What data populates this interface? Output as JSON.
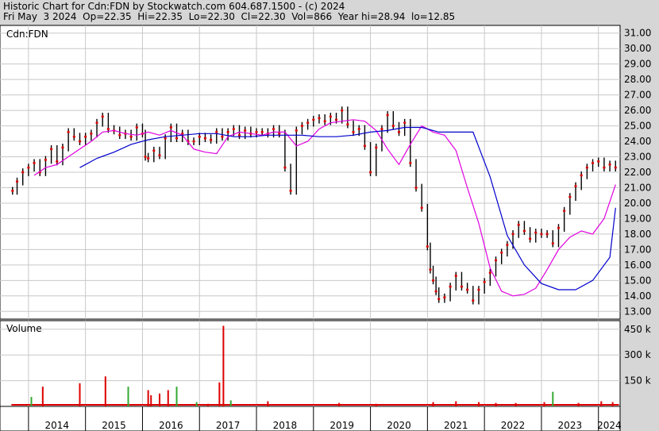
{
  "header": {
    "title": "Historic Chart for Cdn:FDN by Stockwatch.com 604.687.1500 - (c) 2024",
    "quote": "Fri May  3 2024  Op=22.35  Hi=22.35  Lo=22.30  Cl=22.30  Vol=866  Year hi=28.94  lo=12.85"
  },
  "colors": {
    "background": "#d6d6d6",
    "plot_bg": "#ffffff",
    "grid": "#c8c8c8",
    "price_bar": "#000000",
    "price_dot": "#d40000",
    "ma_short": "#e000e0",
    "ma_long": "#0000cc",
    "vol_up": "#33aa33",
    "vol_down": "#dd0000"
  },
  "chart_data": [
    {
      "type": "line",
      "symbol": "Cdn:FDN",
      "ylim": [
        12.5,
        31.5
      ],
      "yticks": [
        13,
        14,
        15,
        16,
        17,
        18,
        19,
        20,
        21,
        22,
        23,
        24,
        25,
        26,
        27,
        28,
        29,
        30,
        31
      ],
      "ytick_labels": [
        "13.00",
        "14.00",
        "15.00",
        "16.00",
        "17.00",
        "18.00",
        "19.00",
        "20.00",
        "21.00",
        "22.00",
        "23.00",
        "24.00",
        "25.00",
        "26.00",
        "27.00",
        "28.00",
        "29.00",
        "30.00",
        "31.00"
      ],
      "x_labels": [
        "2014",
        "2015",
        "2016",
        "2017",
        "2018",
        "2019",
        "2020",
        "2021",
        "2022",
        "2023",
        "2024"
      ],
      "x_label_pos": [
        2014.0,
        2015.0,
        2016.0,
        2017.0,
        2018.0,
        2019.0,
        2020.0,
        2021.0,
        2022.0,
        2023.0,
        2024.0
      ],
      "x_range": [
        2013.5,
        2024.38
      ],
      "series": [
        {
          "name": "",
          "role": "price",
          "x": [
            2013.72,
            2013.8,
            2013.9,
            2014.0,
            2014.1,
            2014.2,
            2014.3,
            2014.4,
            2014.5,
            2014.6,
            2014.7,
            2014.8,
            2014.9,
            2015.0,
            2015.1,
            2015.2,
            2015.3,
            2015.4,
            2015.5,
            2015.6,
            2015.7,
            2015.8,
            2015.9,
            2016.0,
            2016.05,
            2016.1,
            2016.2,
            2016.3,
            2016.4,
            2016.5,
            2016.6,
            2016.7,
            2016.8,
            2016.9,
            2017.0,
            2017.1,
            2017.2,
            2017.3,
            2017.4,
            2017.5,
            2017.6,
            2017.7,
            2017.8,
            2017.9,
            2018.0,
            2018.1,
            2018.2,
            2018.3,
            2018.4,
            2018.5,
            2018.6,
            2018.7,
            2018.8,
            2018.9,
            2019.0,
            2019.1,
            2019.2,
            2019.3,
            2019.4,
            2019.5,
            2019.6,
            2019.7,
            2019.8,
            2019.9,
            2020.0,
            2020.1,
            2020.2,
            2020.3,
            2020.4,
            2020.5,
            2020.6,
            2020.7,
            2020.8,
            2020.9,
            2021.0,
            2021.05,
            2021.1,
            2021.15,
            2021.2,
            2021.3,
            2021.4,
            2021.5,
            2021.6,
            2021.7,
            2021.8,
            2021.9,
            2022.0,
            2022.1,
            2022.2,
            2022.3,
            2022.4,
            2022.5,
            2022.6,
            2022.7,
            2022.8,
            2022.9,
            2023.0,
            2023.1,
            2023.2,
            2023.3,
            2023.4,
            2023.5,
            2023.6,
            2023.7,
            2023.8,
            2023.9,
            2024.0,
            2024.1,
            2024.2,
            2024.3
          ],
          "y": [
            20.8,
            21.4,
            22.0,
            22.3,
            22.6,
            22.0,
            22.8,
            23.5,
            22.7,
            23.6,
            24.6,
            24.3,
            24.0,
            24.3,
            24.5,
            25.2,
            25.6,
            24.8,
            24.7,
            24.4,
            24.5,
            24.3,
            24.9,
            24.5,
            23.0,
            22.9,
            23.4,
            23.1,
            24.2,
            24.9,
            24.2,
            24.5,
            24.0,
            24.0,
            24.3,
            24.2,
            24.1,
            24.6,
            24.3,
            24.6,
            24.8,
            24.4,
            24.7,
            24.5,
            24.6,
            24.6,
            24.5,
            24.8,
            24.5,
            22.3,
            20.8,
            24.7,
            25.0,
            25.2,
            25.4,
            25.5,
            25.3,
            25.6,
            25.4,
            26.0,
            25.1,
            24.6,
            24.8,
            23.7,
            22.0,
            23.6,
            24.8,
            25.7,
            25.0,
            24.6,
            25.2,
            22.6,
            21.0,
            19.7,
            17.2,
            15.7,
            15.0,
            14.3,
            13.8,
            13.9,
            14.6,
            15.3,
            14.6,
            14.4,
            13.7,
            14.4,
            14.9,
            15.5,
            16.3,
            16.8,
            17.3,
            18.0,
            18.6,
            18.2,
            17.7,
            18.1,
            18.0,
            18.0,
            17.4,
            18.4,
            19.5,
            20.4,
            21.1,
            21.8,
            22.3,
            22.6,
            22.7,
            22.3,
            22.5,
            22.3
          ]
        },
        {
          "name": "",
          "role": "moving_average_short",
          "x": [
            2014.1,
            2014.3,
            2014.5,
            2014.7,
            2014.9,
            2015.1,
            2015.3,
            2015.5,
            2015.7,
            2015.9,
            2016.1,
            2016.3,
            2016.5,
            2016.7,
            2016.9,
            2017.1,
            2017.3,
            2017.5,
            2017.7,
            2017.9,
            2018.1,
            2018.3,
            2018.5,
            2018.7,
            2018.9,
            2019.1,
            2019.3,
            2019.5,
            2019.7,
            2019.9,
            2020.1,
            2020.3,
            2020.5,
            2020.7,
            2020.9,
            2021.1,
            2021.3,
            2021.5,
            2021.7,
            2021.9,
            2022.1,
            2022.3,
            2022.5,
            2022.7,
            2022.9,
            2023.1,
            2023.3,
            2023.5,
            2023.7,
            2023.9,
            2024.1,
            2024.3
          ],
          "y": [
            21.8,
            22.3,
            22.5,
            23.0,
            23.5,
            24.0,
            24.6,
            24.7,
            24.5,
            24.4,
            24.6,
            24.4,
            24.7,
            24.4,
            23.5,
            23.3,
            23.2,
            24.3,
            24.6,
            24.5,
            24.4,
            24.6,
            24.6,
            23.7,
            24.0,
            24.8,
            25.2,
            25.3,
            25.4,
            25.3,
            24.7,
            23.5,
            22.5,
            23.8,
            25.0,
            24.6,
            24.4,
            23.4,
            21.0,
            18.7,
            15.8,
            14.3,
            14.0,
            14.1,
            14.5,
            15.7,
            17.0,
            17.8,
            18.2,
            18.0,
            19.0,
            21.2
          ]
        },
        {
          "name": "",
          "role": "moving_average_long",
          "x": [
            2014.9,
            2015.2,
            2015.5,
            2015.8,
            2016.1,
            2016.4,
            2016.7,
            2017.0,
            2017.3,
            2017.6,
            2017.9,
            2018.2,
            2018.5,
            2018.8,
            2019.1,
            2019.4,
            2019.7,
            2020.0,
            2020.3,
            2020.6,
            2020.9,
            2021.2,
            2021.5,
            2021.8,
            2022.1,
            2022.4,
            2022.7,
            2023.0,
            2023.3,
            2023.6,
            2023.9,
            2024.2,
            2024.3
          ],
          "y": [
            22.3,
            22.9,
            23.3,
            23.8,
            24.1,
            24.3,
            24.4,
            24.5,
            24.5,
            24.3,
            24.3,
            24.4,
            24.4,
            24.4,
            24.3,
            24.3,
            24.4,
            24.6,
            24.7,
            24.9,
            24.9,
            24.6,
            24.6,
            24.6,
            21.7,
            17.9,
            16.0,
            14.8,
            14.4,
            14.4,
            15.0,
            16.5,
            19.7
          ]
        }
      ]
    },
    {
      "type": "bar",
      "title": "Volume",
      "ylim": [
        0,
        500000
      ],
      "yticks": [
        150000,
        300000,
        450000
      ],
      "ytick_labels": [
        "150 k",
        "300 k",
        "450 k"
      ],
      "x_range": [
        2013.5,
        2024.38
      ],
      "x": [
        2014.05,
        2014.25,
        2014.9,
        2015.35,
        2015.75,
        2016.1,
        2016.15,
        2016.3,
        2016.45,
        2016.6,
        2016.95,
        2017.15,
        2017.35,
        2017.42,
        2017.55,
        2018.2,
        2019.45,
        2020.1,
        2021.1,
        2021.5,
        2021.9,
        2022.2,
        2022.55,
        2023.05,
        2023.2,
        2023.65,
        2024.05,
        2024.25
      ],
      "values": [
        55000,
        115000,
        135000,
        175000,
        115000,
        95000,
        65000,
        75000,
        95000,
        115000,
        25000,
        15000,
        140000,
        470000,
        35000,
        30000,
        20000,
        15000,
        25000,
        30000,
        25000,
        20000,
        20000,
        25000,
        85000,
        20000,
        30000,
        25000
      ],
      "direction": [
        "up",
        "down",
        "down",
        "down",
        "up",
        "down",
        "down",
        "down",
        "down",
        "up",
        "up",
        "down",
        "down",
        "down",
        "up",
        "down",
        "down",
        "down",
        "down",
        "down",
        "down",
        "down",
        "down",
        "down",
        "up",
        "down",
        "down",
        "down"
      ]
    }
  ]
}
